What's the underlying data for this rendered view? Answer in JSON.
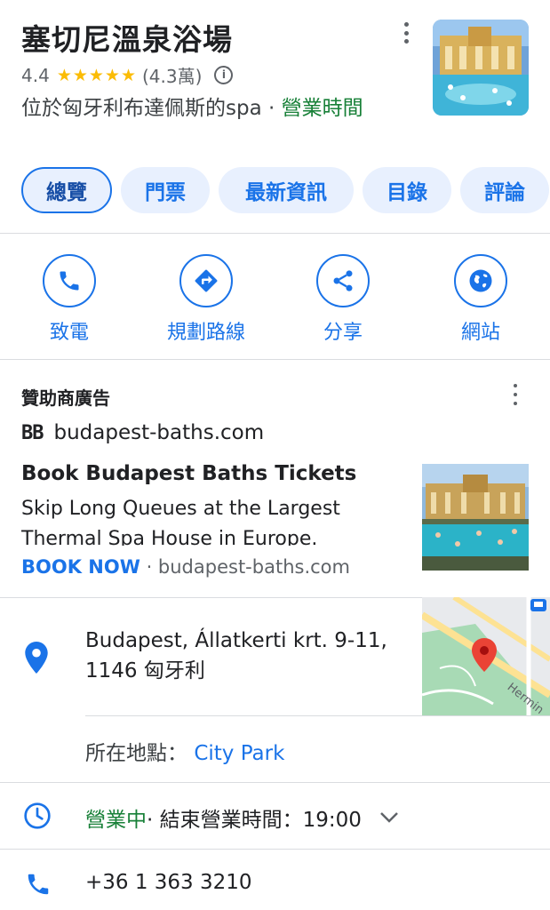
{
  "place": {
    "title": "塞切尼溫泉浴場",
    "rating": "4.4",
    "stars": "★★★★★",
    "review_count": "(4.3萬)",
    "info_icon": "info-icon",
    "description": "位於匈牙利布達佩斯的spa",
    "separator": " · ",
    "hours_link": "營業時間"
  },
  "tabs": [
    {
      "label": "總覽"
    },
    {
      "label": "門票"
    },
    {
      "label": "最新資訊"
    },
    {
      "label": "目錄"
    },
    {
      "label": "評論"
    }
  ],
  "actions": [
    {
      "label": "致電",
      "icon": "phone-icon"
    },
    {
      "label": "規劃路線",
      "icon": "directions-icon"
    },
    {
      "label": "分享",
      "icon": "share-icon"
    },
    {
      "label": "網站",
      "icon": "globe-icon"
    }
  ],
  "ad": {
    "label": "贊助商廣告",
    "logo": "BB",
    "domain": "budapest-baths.com",
    "title": "Book Budapest Baths Tickets",
    "body": "Skip Long Queues at the Largest Thermal Spa House in Europe.",
    "cta": "BOOK NOW",
    "cta_domain": " · budapest-baths.com"
  },
  "address": {
    "line1": "Budapest, Állatkerti krt. 9-11,",
    "line2": "1146 匈牙利",
    "map_street_label": "Hermin",
    "located_in_label": "所在地點：",
    "located_in_value": "City Park"
  },
  "hours": {
    "status": "營業中",
    "detail": " · 結束營業時間：19:00"
  },
  "phone": {
    "number": "+36 1 363 3210"
  },
  "colors": {
    "accent": "#1a73e8",
    "open_green": "#188038",
    "star": "#fbbc04",
    "pin": "#ea4335"
  }
}
